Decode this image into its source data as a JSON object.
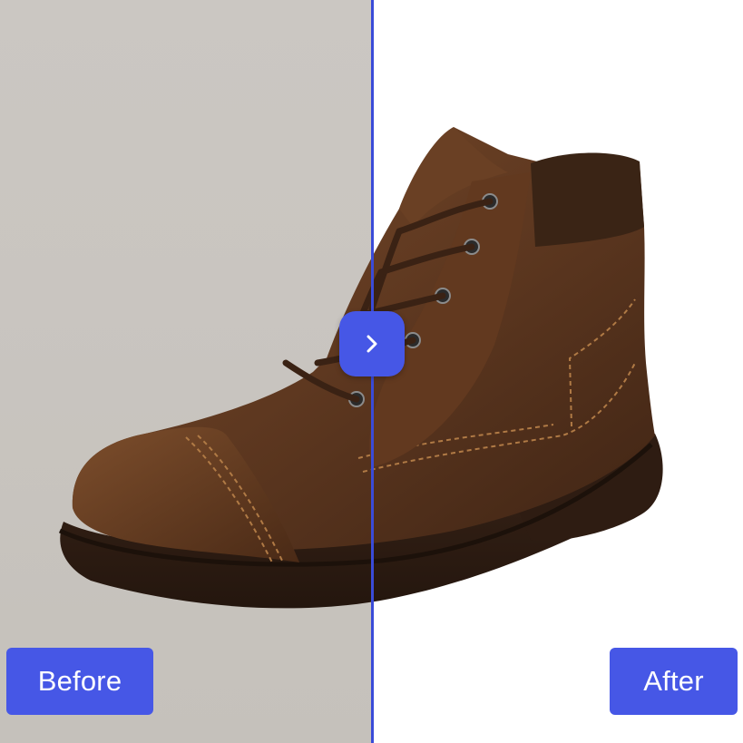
{
  "comparison": {
    "before_label": "Before",
    "after_label": "After"
  },
  "handle": {
    "icon": "chevron-right-icon"
  },
  "colors": {
    "accent": "#4657E6",
    "divider": "#3A4BD8",
    "before_background": "#C9C5C0",
    "after_background": "#FFFFFF",
    "leather": "#5A3620"
  },
  "image": {
    "subject_icon": "brown-leather-boot-image"
  }
}
